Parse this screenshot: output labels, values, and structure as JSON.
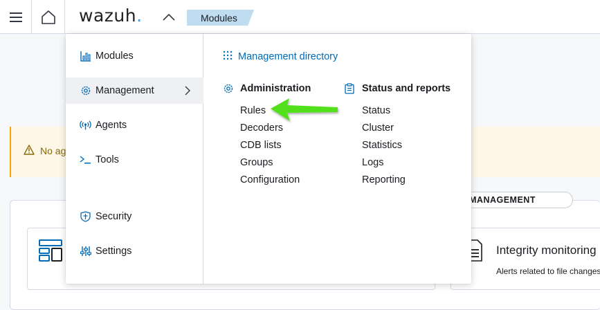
{
  "topbar": {
    "logo_text": "wazuh",
    "logo_dot": ".",
    "breadcrumb": "Modules"
  },
  "background": {
    "callout_text": "No ag",
    "tab_label": "MANAGEMENT",
    "card_right": {
      "title": "Integrity monitoring",
      "description": "Alerts related to file changes"
    }
  },
  "menu": {
    "sidebar": [
      {
        "label": "Modules",
        "icon": "chart-icon"
      },
      {
        "label": "Management",
        "icon": "gear-icon",
        "active": true
      },
      {
        "label": "Agents",
        "icon": "antenna-icon"
      },
      {
        "label": "Tools",
        "icon": "console-icon"
      },
      {
        "label": "Security",
        "icon": "shield-icon"
      },
      {
        "label": "Settings",
        "icon": "sliders-icon"
      }
    ],
    "directory_link": "Management directory",
    "administration": {
      "title": "Administration",
      "items": [
        "Rules",
        "Decoders",
        "CDB lists",
        "Groups",
        "Configuration"
      ]
    },
    "status_reports": {
      "title": "Status and reports",
      "items": [
        "Status",
        "Cluster",
        "Statistics",
        "Logs",
        "Reporting"
      ]
    }
  },
  "colors": {
    "link": "#006bb8",
    "breadcrumb_bg": "#bfdcf0",
    "active_bg": "#eef0f3",
    "arrow": "#53e01e",
    "callout_bg": "#fef6e6"
  }
}
